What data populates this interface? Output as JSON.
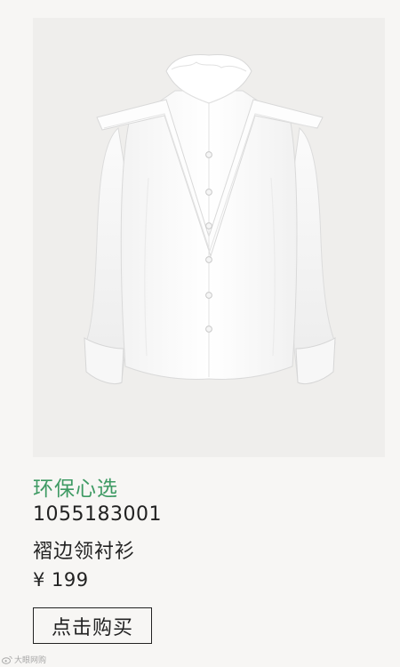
{
  "product": {
    "tag_label": "环保心选",
    "sku": "1055183001",
    "name": "褶边领衬衫",
    "price": "¥ 199",
    "image_icon": "white-ruffle-collar-shirt",
    "tag_color": "#3e9a63"
  },
  "actions": {
    "buy_label": "点击购买"
  },
  "watermark": {
    "icon": "weibo-icon",
    "text": "大眼网购"
  }
}
